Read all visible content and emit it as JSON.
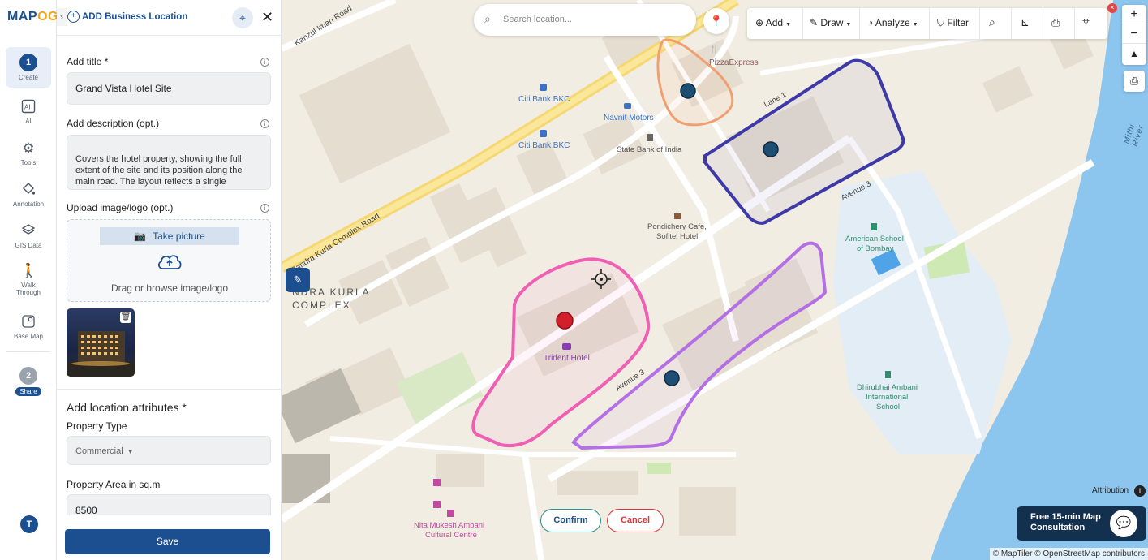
{
  "app": {
    "logo_main": "MAP",
    "logo_accent": "OG"
  },
  "rail": {
    "steps": [
      {
        "number": "1",
        "label": "Create"
      },
      {
        "number": "2",
        "label": "Share"
      }
    ],
    "items": [
      {
        "label": "AI",
        "icon": "ai-icon"
      },
      {
        "label": "Tools",
        "icon": "gear-icon"
      },
      {
        "label": "Annotation",
        "icon": "paint-bucket-icon"
      },
      {
        "label": "GIS Data",
        "icon": "layers-icon"
      },
      {
        "label": "Walk Through",
        "icon": "walker-icon"
      },
      {
        "label": "Base Map",
        "icon": "base-map-icon"
      }
    ],
    "avatar": "T"
  },
  "panel": {
    "title": "ADD Business Location",
    "fields": {
      "title_label": "Add title *",
      "title_value": "Grand Vista Hotel Site",
      "description_label": "Add description (opt.)",
      "description_value": "Covers the hotel property, showing the full extent of the site and its position along the main road. The layout reflects a single",
      "upload_label": "Upload image/logo (opt.)",
      "take_picture": "Take picture",
      "drag_text": "Drag or browse image/logo"
    },
    "attributes": {
      "section_title": "Add location attributes *",
      "property_type_label": "Property Type",
      "property_type_value": "Commercial",
      "area_label": "Property Area in sq.m",
      "area_value": "8500"
    },
    "save": "Save"
  },
  "map": {
    "search_placeholder": "Search location...",
    "toolbar": {
      "add": "Add",
      "draw": "Draw",
      "analyze": "Analyze",
      "filter": "Filter"
    },
    "labels": {
      "kanzul": "Kanzul Iman Road",
      "bkc_road": "Bandra Kurla Complex Road",
      "bkc_1": "NDRA KURLA",
      "bkc_2": "COMPLEX",
      "pizza": "PizzaExpress",
      "citi1": "Citi Bank BKC",
      "citi2": "Citi Bank BKC",
      "navnit": "Navnit Motors",
      "sbi": "State Bank of India",
      "pondi": "Pondichery Cafe,",
      "sofitel": "Sofitel Hotel",
      "trident": "Trident Hotel",
      "lane1": "Lane 1",
      "ave3a": "Avenue 3",
      "ave3b": "Avenue 3",
      "american1": "American School",
      "american2": "of Bombay",
      "dhirubhai1": "Dhirubhai Ambani",
      "dhirubhai2": "International",
      "dhirubhai3": "School",
      "nita1": "Nita Mukesh Ambani",
      "nita2": "Cultural Centre",
      "mithi": "Mithi River"
    },
    "confirm": "Confirm",
    "cancel": "Cancel",
    "attribution": "Attribution",
    "consult_line1": "Free 15-min Map",
    "consult_line2": "Consultation",
    "copyright": "© MapTiler © OpenStreetMap contributors",
    "polygon_colors": {
      "orange": "#f0a070",
      "navy": "#3d3aa8",
      "pink": "#ef5fb4",
      "violet": "#b36fe3"
    }
  }
}
